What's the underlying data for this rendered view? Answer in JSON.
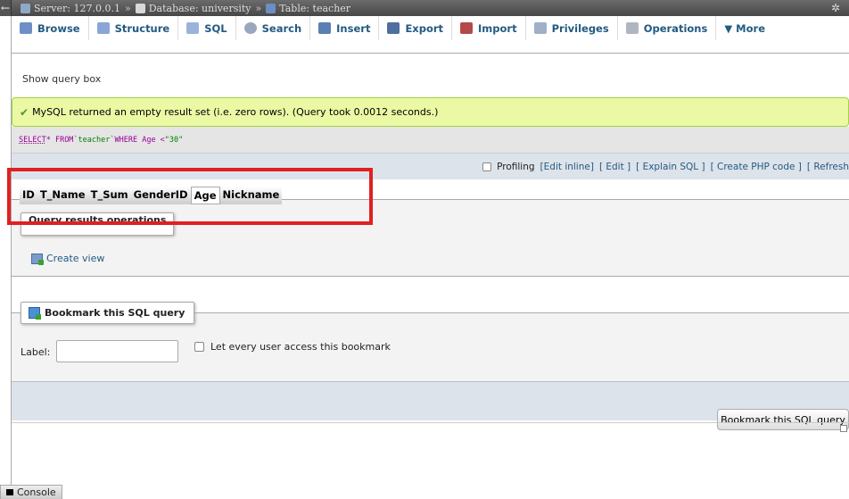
{
  "topbar": {
    "back_label": "←",
    "server_label": "Server: 127.0.0.1",
    "sep1": "»",
    "database_label": "Database: university",
    "sep2": "»",
    "table_label": "Table: teacher",
    "settings_icon": "gear-icon"
  },
  "tabs": [
    {
      "label": "Browse",
      "icon": "browse-icon",
      "color": "#6d8fc9"
    },
    {
      "label": "Structure",
      "icon": "structure-icon",
      "color": "#8aa6d6"
    },
    {
      "label": "SQL",
      "icon": "sql-icon",
      "color": "#9bb3db"
    },
    {
      "label": "Search",
      "icon": "search-icon",
      "color": "#9aa8bd"
    },
    {
      "label": "Insert",
      "icon": "insert-icon",
      "color": "#5a7fb5"
    },
    {
      "label": "Export",
      "icon": "export-icon",
      "color": "#4e6f9f"
    },
    {
      "label": "Import",
      "icon": "import-icon",
      "color": "#b34a4a"
    },
    {
      "label": "Privileges",
      "icon": "privileges-icon",
      "color": "#9fb0c8"
    },
    {
      "label": "Operations",
      "icon": "operations-icon",
      "color": "#b0b6c0"
    },
    {
      "label": "▼ More",
      "icon": "",
      "color": ""
    }
  ],
  "main": {
    "show_query_box": "Show query box",
    "success_message": "MySQL returned an empty result set (i.e. zero rows). (Query took 0.0012 seconds.)",
    "sql": {
      "select": "SELECT",
      "star_from": " * FROM ",
      "table": "`teacher`",
      "where": " WHERE Age < ",
      "value": "\"30\""
    },
    "ops": {
      "profiling": "Profiling",
      "edit_inline": "[Edit inline]",
      "edit": "[ Edit ]",
      "explain": "[ Explain SQL ]",
      "php": "[ Create PHP code ]",
      "refresh": "[ Refresh"
    },
    "columns": [
      "ID",
      "T_Name",
      "T_Sum",
      "GenderID",
      "Age",
      "Nickname"
    ],
    "selected_column": "Age",
    "query_results_ops": "Query results operations",
    "create_view": "Create view",
    "bookmark": {
      "legend": "Bookmark this SQL query",
      "label": "Label:",
      "label_value": "",
      "public_label": "Let every user access this bookmark",
      "submit": "Bookmark this SQL query"
    },
    "console": "Console"
  },
  "colors": {
    "accent": "#235a81",
    "success_bg": "#ebf8a4",
    "highlight": "#e02020"
  }
}
